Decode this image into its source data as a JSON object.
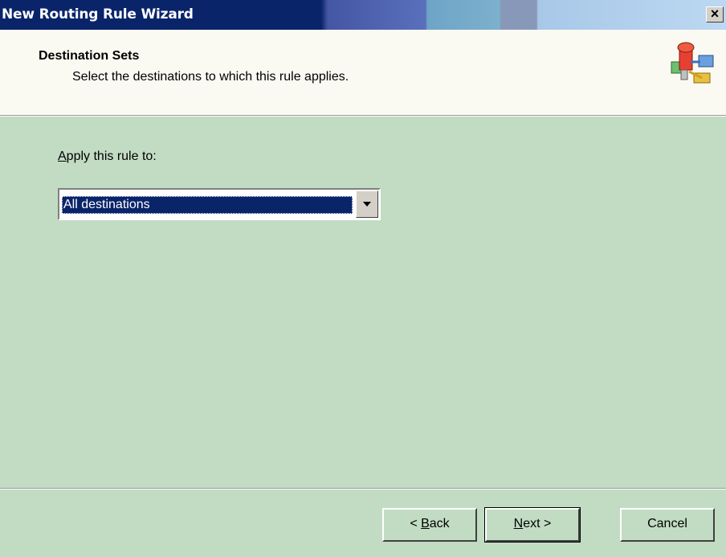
{
  "window": {
    "title": "New Routing Rule Wizard",
    "close_label": "×"
  },
  "header": {
    "title": "Destination Sets",
    "subtitle": "Select the destinations to which this rule applies.",
    "icon": "routing-rule-icon"
  },
  "form": {
    "label_access_key": "A",
    "label_rest": "pply this rule to:",
    "combo_value": "All destinations"
  },
  "buttons": {
    "back_prefix": "< ",
    "back_key": "B",
    "back_rest": "ack",
    "next_key": "N",
    "next_rest": "ext >",
    "cancel": "Cancel"
  },
  "colors": {
    "body": "#c2dcc4",
    "header": "#fbfaf2",
    "titlebar": "#0a246a",
    "selection": "#0a246a"
  }
}
